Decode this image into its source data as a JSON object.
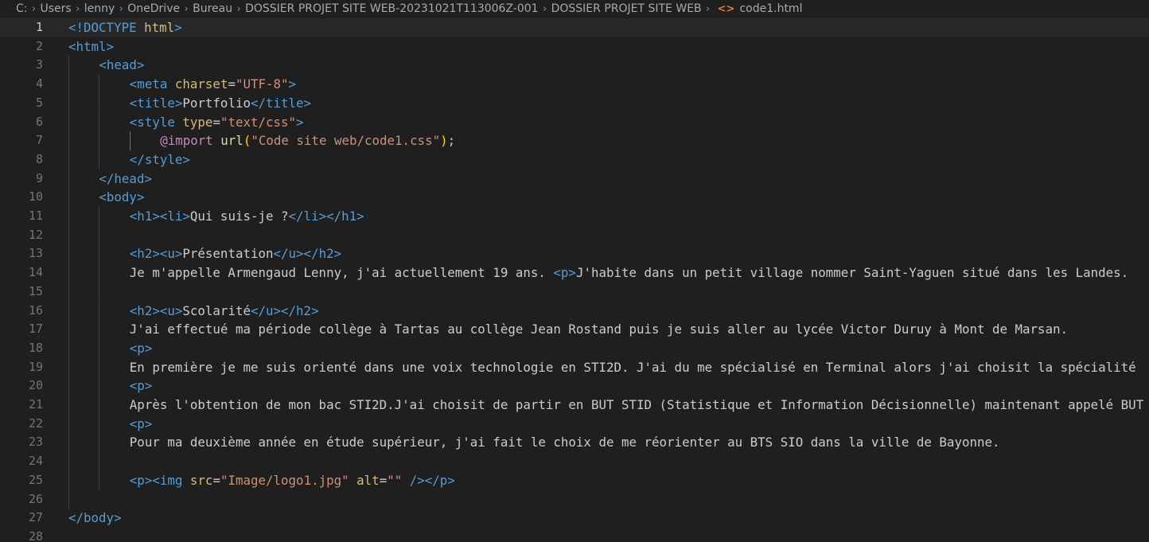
{
  "breadcrumb": {
    "items": [
      "C:",
      "Users",
      "lenny",
      "OneDrive",
      "Bureau",
      "DOSSIER PROJET SITE WEB-20231021T113006Z-001",
      "DOSSIER PROJET SITE WEB"
    ],
    "file_name": "code1.html",
    "file_icon": "html-file-icon"
  },
  "editor": {
    "current_line": 1,
    "lines": [
      {
        "n": "1",
        "indent": 0,
        "tokens": [
          [
            "tag",
            "<!DOCTYPE"
          ],
          [
            "text",
            " "
          ],
          [
            "doctype",
            "html"
          ],
          [
            "tag",
            ">"
          ]
        ]
      },
      {
        "n": "2",
        "indent": 0,
        "tokens": [
          [
            "tag",
            "<html>"
          ]
        ]
      },
      {
        "n": "3",
        "indent": 1,
        "tokens": [
          [
            "tag",
            "<head>"
          ]
        ]
      },
      {
        "n": "4",
        "indent": 2,
        "tokens": [
          [
            "tag",
            "<meta"
          ],
          [
            "text",
            " "
          ],
          [
            "attr",
            "charset"
          ],
          [
            "text",
            "="
          ],
          [
            "str",
            "\"UTF-8\""
          ],
          [
            "tag",
            ">"
          ]
        ]
      },
      {
        "n": "5",
        "indent": 2,
        "tokens": [
          [
            "tag",
            "<title>"
          ],
          [
            "text",
            "Portfolio"
          ],
          [
            "tag",
            "</title>"
          ]
        ]
      },
      {
        "n": "6",
        "indent": 2,
        "tokens": [
          [
            "tag",
            "<style"
          ],
          [
            "text",
            " "
          ],
          [
            "attr",
            "type"
          ],
          [
            "text",
            "="
          ],
          [
            "str",
            "\"text/css\""
          ],
          [
            "tag",
            ">"
          ]
        ]
      },
      {
        "n": "7",
        "indent": 3,
        "tokens": [
          [
            "at",
            "@import"
          ],
          [
            "text",
            " "
          ],
          [
            "fn",
            "url"
          ],
          [
            "paren",
            "("
          ],
          [
            "str",
            "\"Code site web/code1.css\""
          ],
          [
            "paren",
            ")"
          ],
          [
            "text",
            ";"
          ]
        ]
      },
      {
        "n": "8",
        "indent": 2,
        "tokens": [
          [
            "tag",
            "</style>"
          ]
        ]
      },
      {
        "n": "9",
        "indent": 1,
        "tokens": [
          [
            "tag",
            "</head>"
          ]
        ]
      },
      {
        "n": "10",
        "indent": 1,
        "tokens": [
          [
            "tag",
            "<body>"
          ]
        ]
      },
      {
        "n": "11",
        "indent": 2,
        "tokens": [
          [
            "tag",
            "<h1><li>"
          ],
          [
            "text",
            "Qui suis-je ?"
          ],
          [
            "tag",
            "</li></h1>"
          ]
        ]
      },
      {
        "n": "12",
        "indent": 2,
        "tokens": []
      },
      {
        "n": "13",
        "indent": 2,
        "tokens": [
          [
            "tag",
            "<h2><u>"
          ],
          [
            "text",
            "Présentation"
          ],
          [
            "tag",
            "</u></h2>"
          ]
        ]
      },
      {
        "n": "14",
        "indent": 2,
        "tokens": [
          [
            "text",
            "Je m'appelle Armengaud Lenny, j'ai actuellement 19 ans. "
          ],
          [
            "tag",
            "<p>"
          ],
          [
            "text",
            "J'habite dans un petit village nommer Saint-Yaguen situé dans les Landes."
          ]
        ]
      },
      {
        "n": "15",
        "indent": 2,
        "tokens": []
      },
      {
        "n": "16",
        "indent": 2,
        "tokens": [
          [
            "tag",
            "<h2><u>"
          ],
          [
            "text",
            "Scolarité"
          ],
          [
            "tag",
            "</u></h2>"
          ]
        ]
      },
      {
        "n": "17",
        "indent": 2,
        "tokens": [
          [
            "text",
            "J'ai effectué ma période collège à Tartas au collège Jean Rostand puis je suis aller au lycée Victor Duruy à Mont de Marsan."
          ]
        ]
      },
      {
        "n": "18",
        "indent": 2,
        "tokens": [
          [
            "tag",
            "<p>"
          ]
        ]
      },
      {
        "n": "19",
        "indent": 2,
        "tokens": [
          [
            "text",
            "En première je me suis orienté dans une voix technologie en STI2D. J'ai du me spécialisé en Terminal alors j'ai choisit la spécialité"
          ]
        ]
      },
      {
        "n": "20",
        "indent": 2,
        "tokens": [
          [
            "tag",
            "<p>"
          ]
        ]
      },
      {
        "n": "21",
        "indent": 2,
        "tokens": [
          [
            "text",
            "Après l'obtention de mon bac STI2D.J'ai choisit de partir en BUT STID (Statistique et Information Décisionnelle) maintenant appelé BUT"
          ]
        ]
      },
      {
        "n": "22",
        "indent": 2,
        "tokens": [
          [
            "tag",
            "<p>"
          ]
        ]
      },
      {
        "n": "23",
        "indent": 2,
        "tokens": [
          [
            "text",
            "Pour ma deuxième année en étude supérieur, j'ai fait le choix de me réorienter au BTS SIO dans la ville de Bayonne."
          ]
        ]
      },
      {
        "n": "24",
        "indent": 2,
        "tokens": []
      },
      {
        "n": "25",
        "indent": 2,
        "tokens": [
          [
            "tag",
            "<p><img"
          ],
          [
            "text",
            " "
          ],
          [
            "attr",
            "src"
          ],
          [
            "text",
            "="
          ],
          [
            "str",
            "\"Image/logo1.jpg\""
          ],
          [
            "text",
            " "
          ],
          [
            "attr",
            "alt"
          ],
          [
            "text",
            "="
          ],
          [
            "str",
            "\"\""
          ],
          [
            "text",
            " "
          ],
          [
            "tag",
            "/></p>"
          ]
        ]
      },
      {
        "n": "26",
        "indent": 1,
        "tokens": []
      },
      {
        "n": "27",
        "indent": 0,
        "tokens": [
          [
            "tag",
            "</body>"
          ]
        ]
      },
      {
        "n": "28",
        "indent": 0,
        "tokens": []
      }
    ]
  },
  "colors": {
    "background": "#1f1f1f",
    "tag": "#569cd6",
    "attribute": "#d7ba7d",
    "string": "#ce9178",
    "text": "#cccccc",
    "at_rule": "#c586c0",
    "function": "#dcdcaa",
    "bracket": "#ffd700",
    "line_number": "#6e7681"
  }
}
